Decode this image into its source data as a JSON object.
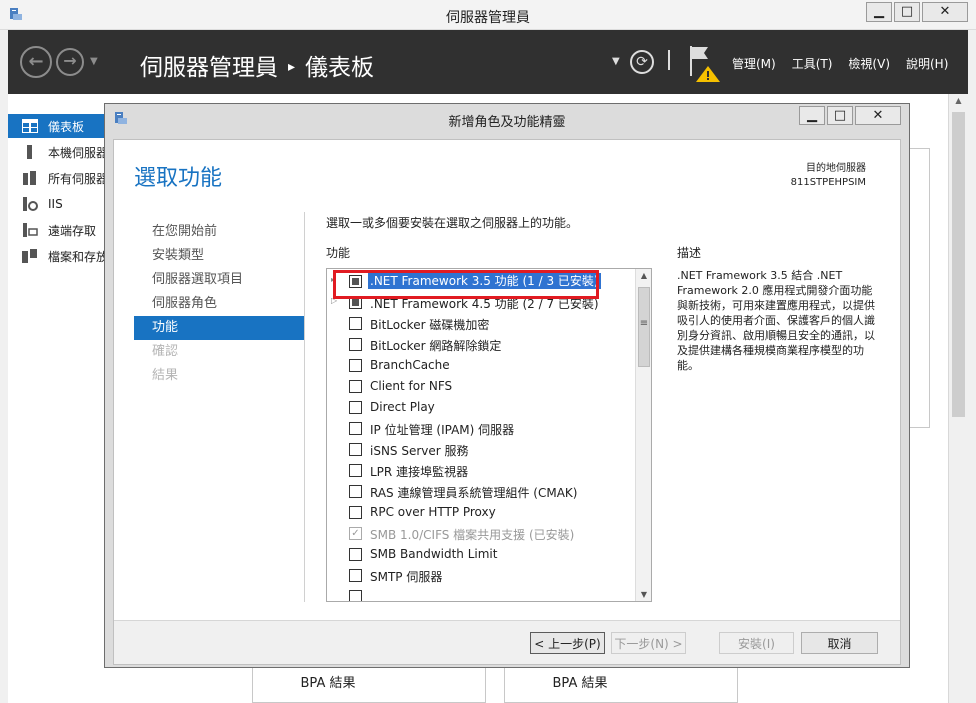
{
  "window": {
    "title": "伺服器管理員",
    "buttons": {
      "minimize": "▁",
      "maximize": "□",
      "close": "✕"
    }
  },
  "header": {
    "breadcrumb_root": "伺服器管理員",
    "breadcrumb_sep": "▸",
    "breadcrumb_page": "儀表板",
    "menus": [
      "管理(M)",
      "工具(T)",
      "檢視(V)",
      "說明(H)"
    ]
  },
  "leftnav": {
    "items": [
      {
        "label": "儀表板",
        "icon": "dashboard-icon",
        "selected": true
      },
      {
        "label": "本機伺服器",
        "icon": "server-icon"
      },
      {
        "label": "所有伺服器",
        "icon": "servers-icon"
      },
      {
        "label": "IIS",
        "icon": "iis-icon"
      },
      {
        "label": "遠端存取",
        "icon": "remote-access-icon"
      },
      {
        "label": "檔案和存放服務",
        "icon": "file-storage-icon"
      }
    ]
  },
  "background": {
    "bpa_left": "BPA 結果",
    "bpa_right": "BPA 結果"
  },
  "dialog": {
    "title": "新增角色及功能精靈",
    "page_title": "選取功能",
    "target_label": "目的地伺服器",
    "target_server": "811STPEHPSIM",
    "steps": [
      {
        "label": "在您開始前",
        "state": "normal"
      },
      {
        "label": "安裝類型",
        "state": "normal"
      },
      {
        "label": "伺服器選取項目",
        "state": "normal"
      },
      {
        "label": "伺服器角色",
        "state": "normal"
      },
      {
        "label": "功能",
        "state": "active"
      },
      {
        "label": "確認",
        "state": "disabled"
      },
      {
        "label": "結果",
        "state": "disabled"
      }
    ],
    "instruction": "選取一或多個要安裝在選取之伺服器上的功能。",
    "features_header": "功能",
    "description_header": "描述",
    "description": ".NET Framework 3.5 結合 .NET Framework 2.0 應用程式開發介面功能與新技術，可用來建置應用程式，以提供吸引人的使用者介面、保護客戶的個人識別身分資訊、啟用順暢且安全的通訊，以及提供建構各種規模商業程序模型的功能。",
    "features": [
      {
        "label": ".NET Framework 3.5 功能 (1 / 3 已安裝)",
        "expander": "▸",
        "state": "partial",
        "highlighted": true
      },
      {
        "label": ".NET Framework 4.5 功能 (2 / 7 已安裝)",
        "expander": "▷",
        "state": "partial"
      },
      {
        "label": "BitLocker 磁碟機加密",
        "state": "unchecked"
      },
      {
        "label": "BitLocker 網路解除鎖定",
        "state": "unchecked"
      },
      {
        "label": "BranchCache",
        "state": "unchecked"
      },
      {
        "label": "Client for NFS",
        "state": "unchecked"
      },
      {
        "label": "Direct Play",
        "state": "unchecked"
      },
      {
        "label": "IP 位址管理 (IPAM) 伺服器",
        "state": "unchecked"
      },
      {
        "label": "iSNS Server 服務",
        "state": "unchecked"
      },
      {
        "label": "LPR 連接埠監視器",
        "state": "unchecked"
      },
      {
        "label": "RAS 連線管理員系統管理組件 (CMAK)",
        "state": "unchecked"
      },
      {
        "label": "RPC over HTTP Proxy",
        "state": "unchecked"
      },
      {
        "label": "SMB 1.0/CIFS 檔案共用支援 (已安裝)",
        "state": "checked-disabled",
        "check": "✓"
      },
      {
        "label": "SMB Bandwidth Limit",
        "state": "unchecked"
      },
      {
        "label": "SMTP 伺服器",
        "state": "unchecked"
      }
    ],
    "buttons": {
      "prev": "< 上一步(P)",
      "next": "下一步(N) >",
      "install": "安裝(I)",
      "cancel": "取消"
    }
  },
  "colors": {
    "accent": "#1873c2",
    "header_bg": "#303030",
    "highlight_box": "#e11b22",
    "selection": "#2f73d1"
  }
}
